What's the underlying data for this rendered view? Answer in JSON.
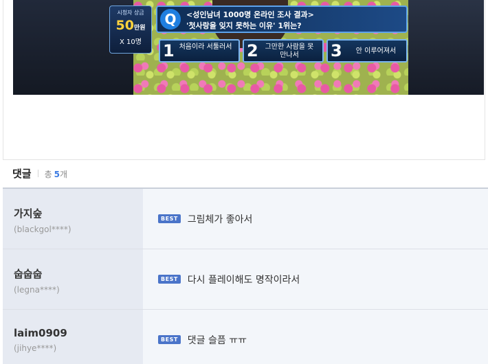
{
  "tv_caption": {
    "prize_title": "시청자 상금",
    "prize_amount": "50",
    "prize_unit": "만원",
    "prize_count": "X 10명",
    "question_mark": "Q",
    "question_line1": "<성인남녀 1000명 온라인 조사 결과>",
    "question_line2": "'첫사랑을 잊지 못하는 이유' 1위는?",
    "answers": [
      {
        "num": "1",
        "text": "처음이라 서툴러서"
      },
      {
        "num": "2",
        "text": "그만한 사람을 못 만나서"
      },
      {
        "num": "3",
        "text": "안 이루어져서"
      }
    ]
  },
  "comments": {
    "title": "댓글",
    "total_label": "총",
    "total_count": "5",
    "total_unit": "개",
    "items": [
      {
        "name": "가지숲",
        "id": "(blackgol****)",
        "badge": "BEST",
        "text": "그림체가 좋아서"
      },
      {
        "name": "숩숩숩",
        "id": "(legna****)",
        "badge": "BEST",
        "text": "다시 플레이해도 명작이라서"
      },
      {
        "name": "laim0909",
        "id": "(jihye****)",
        "badge": "BEST",
        "text": "댓글 슬픔 ㅠㅠ"
      }
    ]
  }
}
